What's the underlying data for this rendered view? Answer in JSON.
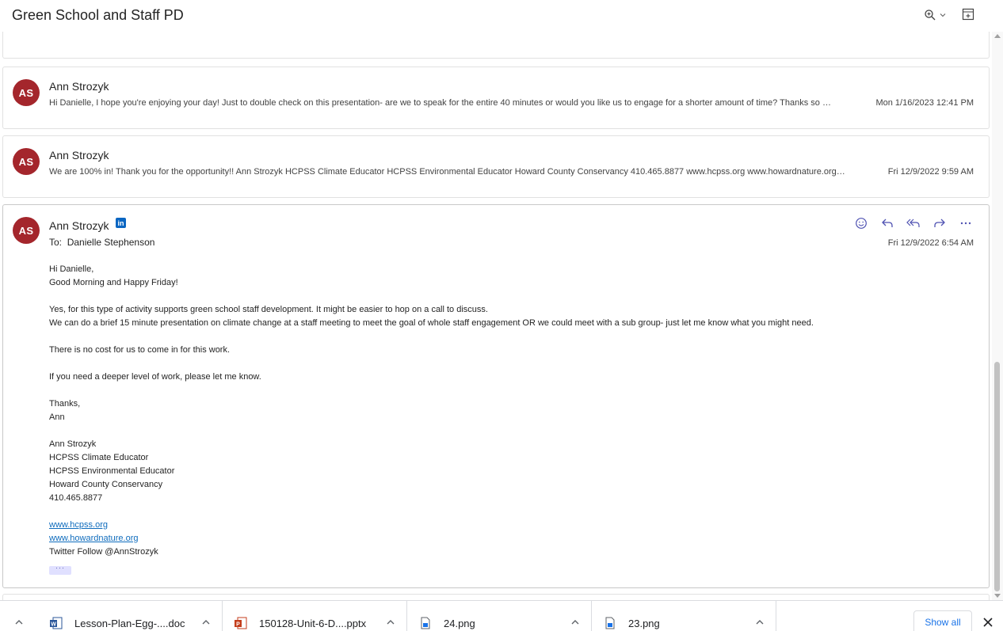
{
  "header": {
    "title": "Green School and Staff PD"
  },
  "messages": [
    {
      "initials": "AS",
      "sender": "Ann Strozyk",
      "preview": "Hi Danielle, I hope you're enjoying your day! Just to double check on this presentation- are we to speak for the entire 40 minutes or would you like us to engage for a shorter amount of time? Thanks so muc...",
      "date": "Mon 1/16/2023 12:41 PM"
    },
    {
      "initials": "AS",
      "sender": "Ann Strozyk",
      "preview": "We are 100% in! Thank you for the opportunity!! Ann Strozyk HCPSS Climate Educator HCPSS Environmental Educator Howard County Conservancy 410.465.8877 www.hcpss.org www.howardnature.org Twitter F...",
      "date": "Fri 12/9/2022 9:59 AM"
    }
  ],
  "open_message": {
    "initials": "AS",
    "sender": "Ann Strozyk",
    "linkedin_label": "in",
    "to_label": "To:",
    "to": "Danielle Stephenson",
    "date": "Fri 12/9/2022 6:54 AM",
    "body": {
      "greeting": "Hi Danielle,",
      "line2": "Good Morning and Happy Friday!",
      "para1_line1": "Yes, for this type of activity supports green school staff development. It might be easier to hop on a call to discuss.",
      "para1_line2": "We can do a brief 15 minute presentation on climate change at a staff meeting to meet the goal of whole staff engagement OR we could meet with a sub group- just let me know what you might need.",
      "para2": "There is no cost for us to come in for this work.",
      "para3": "If you need a deeper level of work, please let me know.",
      "closing": "Thanks,",
      "closing_name": "Ann",
      "sig_name": "Ann Strozyk",
      "sig_title1": "HCPSS Climate Educator",
      "sig_title2": "HCPSS Environmental Educator",
      "sig_org": "Howard County Conservancy",
      "sig_phone": "410.465.8877",
      "link1": "www.hcpss.org",
      "link2": "www.howardnature.org",
      "twitter": "Twitter Follow @AnnStrozyk"
    },
    "more_label": "···"
  },
  "downloads": {
    "items": [
      {
        "name": "Lesson-Plan-Egg-....doc",
        "type": "word"
      },
      {
        "name": "150128-Unit-6-D....pptx",
        "type": "powerpoint"
      },
      {
        "name": "24.png",
        "type": "image"
      },
      {
        "name": "23.png",
        "type": "image"
      }
    ],
    "show_all_label": "Show all"
  },
  "colors": {
    "avatar": "#a4262c",
    "accent": "#4f52b2",
    "link": "#0f6cbd",
    "linkedin": "#0a66c2",
    "chrome_blue": "#1a73e8"
  }
}
